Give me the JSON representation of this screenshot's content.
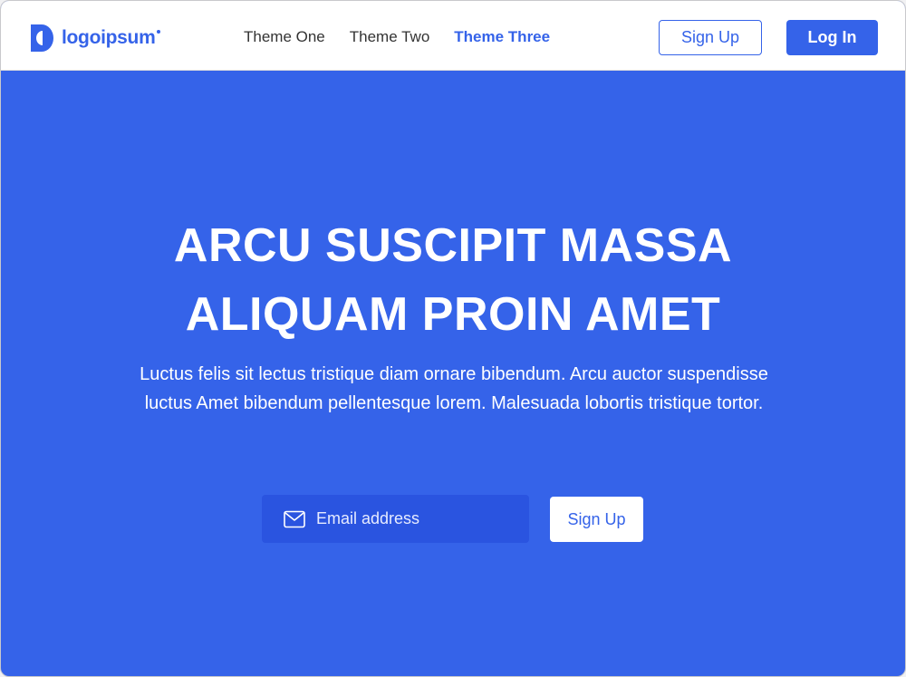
{
  "nav": {
    "logo_text": "logoipsum",
    "links": [
      {
        "label": "Theme One",
        "active": false
      },
      {
        "label": "Theme Two",
        "active": false
      },
      {
        "label": "Theme Three",
        "active": true
      }
    ],
    "signup_label": "Sign Up",
    "login_label": "Log In"
  },
  "hero": {
    "title_line1": "ARCU SUSCIPIT MASSA",
    "title_line2": "ALIQUAM PROIN AMET",
    "description": "Luctus felis sit lectus tristique diam ornare bibendum. Arcu auctor suspendisse luctus Amet bibendum pellentesque lorem. Malesuada lobortis tristique tortor.",
    "email_placeholder": "Email address",
    "email_icon": "mail-icon",
    "signup_label": "Sign Up"
  },
  "colors": {
    "accent": "#3563e9",
    "input_bg": "#2a54e0",
    "nav_bg": "#ffffff",
    "text_dark": "#333333"
  }
}
